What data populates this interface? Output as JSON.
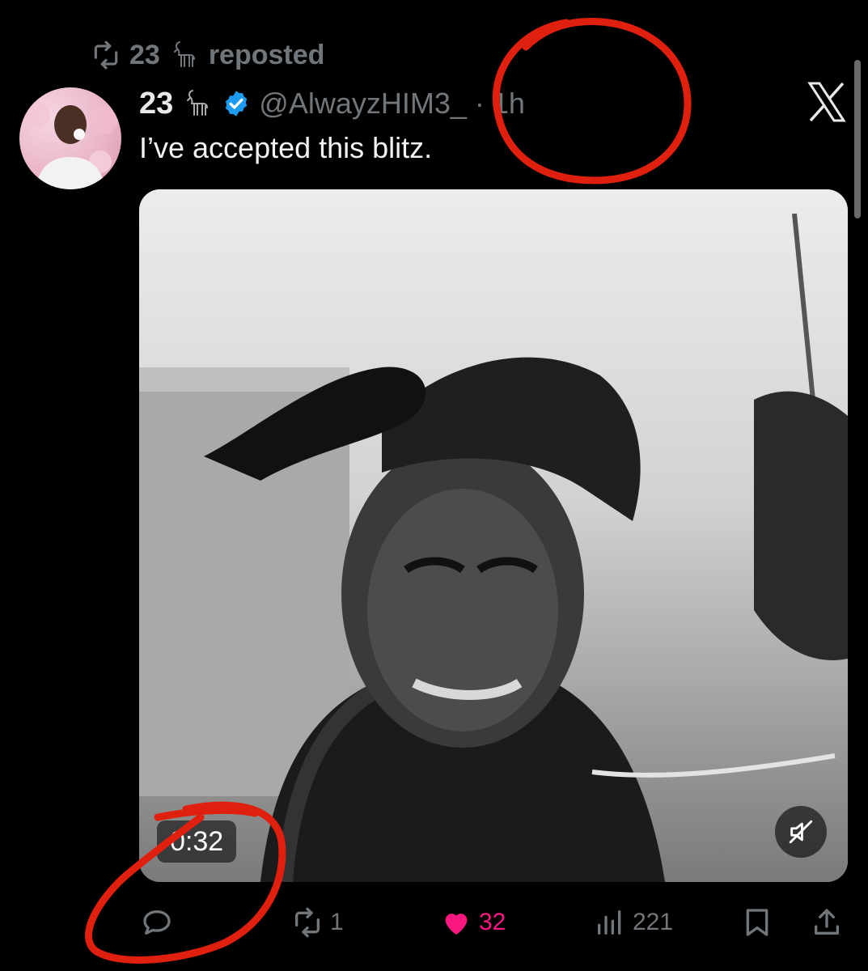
{
  "repost_banner": {
    "name": "23",
    "label": "reposted",
    "repost_icon": "repost-icon",
    "goat_icon": "goat-icon"
  },
  "tweet": {
    "display_name": "23",
    "handle": "@AlwayzHIM3_",
    "separator": "·",
    "time": "1h",
    "text": "I’ve accepted this blitz.",
    "verified_icon": "verified-badge-icon",
    "verified_color": "#1d9bf0",
    "app_logo": "x-logo-icon"
  },
  "media": {
    "type": "video",
    "duration": "0:32",
    "mute_icon": "muted-speaker-icon"
  },
  "actions": {
    "reply": {
      "icon": "reply-icon",
      "count": ""
    },
    "repost": {
      "icon": "repost-icon",
      "count": "1"
    },
    "like": {
      "icon": "heart-icon",
      "count": "32",
      "color": "#f91880"
    },
    "views": {
      "icon": "views-icon",
      "count": "221"
    },
    "bookmark": {
      "icon": "bookmark-icon"
    },
    "share": {
      "icon": "share-icon"
    }
  },
  "colors": {
    "background": "#000000",
    "muted_text": "#71767b",
    "primary_text": "#e7e9ea",
    "annotation_red": "#e0200f"
  }
}
